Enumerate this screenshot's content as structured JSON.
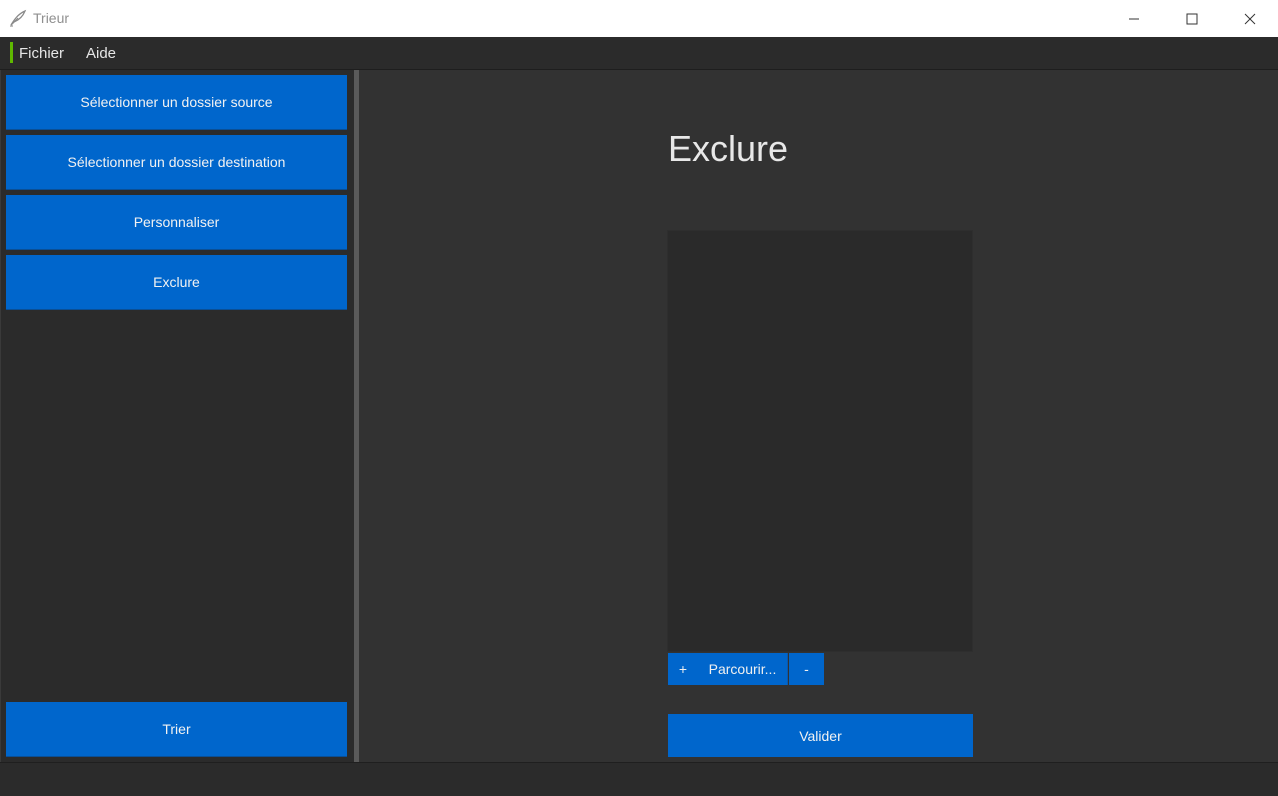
{
  "window": {
    "title": "Trieur",
    "icon": "feather-quill-icon"
  },
  "menubar": {
    "items": [
      "Fichier",
      "Aide"
    ],
    "accent_color": "#5fb800"
  },
  "sidebar": {
    "buttons": [
      "Sélectionner un dossier source",
      "Sélectionner un dossier destination",
      "Personnaliser",
      "Exclure"
    ],
    "sort_button": "Trier"
  },
  "main": {
    "title": "Exclure",
    "exclude_list": [],
    "list_controls": {
      "add": "+",
      "browse": "Parcourir...",
      "remove": "-"
    },
    "validate": "Valider"
  },
  "colors": {
    "accent": "#0066cc",
    "background": "#323232",
    "sidebar": "#2b2b2b"
  }
}
